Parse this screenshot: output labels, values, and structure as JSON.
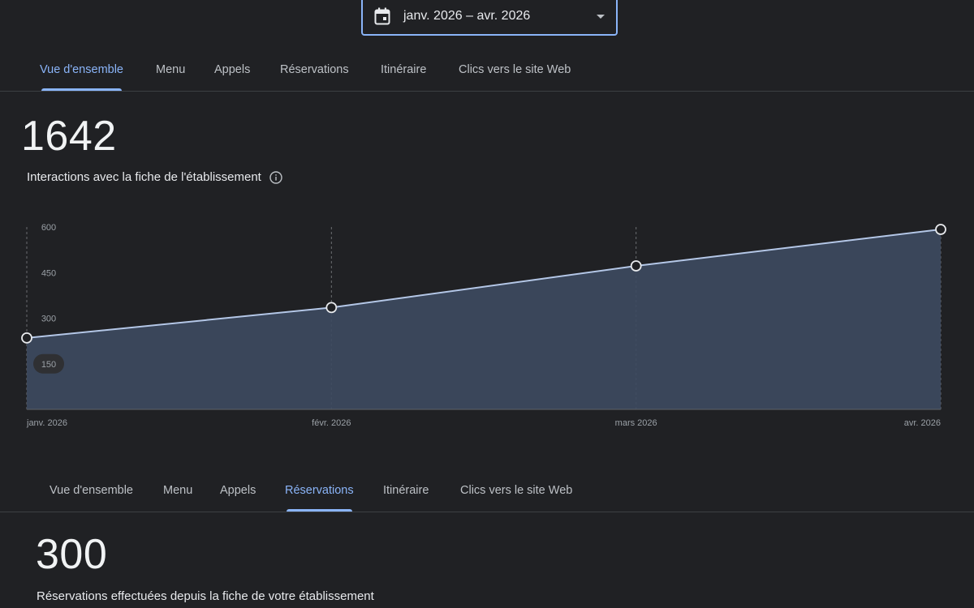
{
  "date_picker": {
    "value": "janv. 2026 – avr. 2026",
    "icon": "calendar-icon"
  },
  "tabs_top": {
    "items": [
      {
        "label": "Vue d'ensemble",
        "active": true
      },
      {
        "label": "Menu",
        "active": false
      },
      {
        "label": "Appels",
        "active": false
      },
      {
        "label": "Réservations",
        "active": false
      },
      {
        "label": "Itinéraire",
        "active": false
      },
      {
        "label": "Clics vers le site Web",
        "active": false
      }
    ]
  },
  "overview": {
    "total": "1642",
    "label": "Interactions avec la fiche de l'établissement"
  },
  "chart_data": {
    "type": "area",
    "x": [
      "janv. 2026",
      "févr. 2026",
      "mars 2026",
      "avr. 2026"
    ],
    "series": [
      {
        "values": [
          235,
          335,
          472,
          592
        ]
      }
    ],
    "ylim": [
      0,
      600
    ],
    "yticks": [
      "600",
      "450",
      "300",
      "150"
    ],
    "ytick_values": [
      600,
      450,
      300,
      150
    ],
    "grid": "vertical dashed",
    "colors": {
      "line": "#b4c7e7",
      "fill": "#3d4a60",
      "point": "#202124"
    }
  },
  "tabs_bottom": {
    "items": [
      {
        "label": "Vue d'ensemble",
        "active": false
      },
      {
        "label": "Menu",
        "active": false
      },
      {
        "label": "Appels",
        "active": false
      },
      {
        "label": "Réservations",
        "active": true
      },
      {
        "label": "Itinéraire",
        "active": false
      },
      {
        "label": "Clics vers le site Web",
        "active": false
      }
    ]
  },
  "reservations": {
    "total": "300",
    "label": "Réservations effectuées depuis la fiche de votre établissement"
  },
  "colors": {
    "background": "#202124",
    "accent": "#8ab4f8",
    "text": "#e8eaed",
    "muted": "#bdc1c6"
  }
}
